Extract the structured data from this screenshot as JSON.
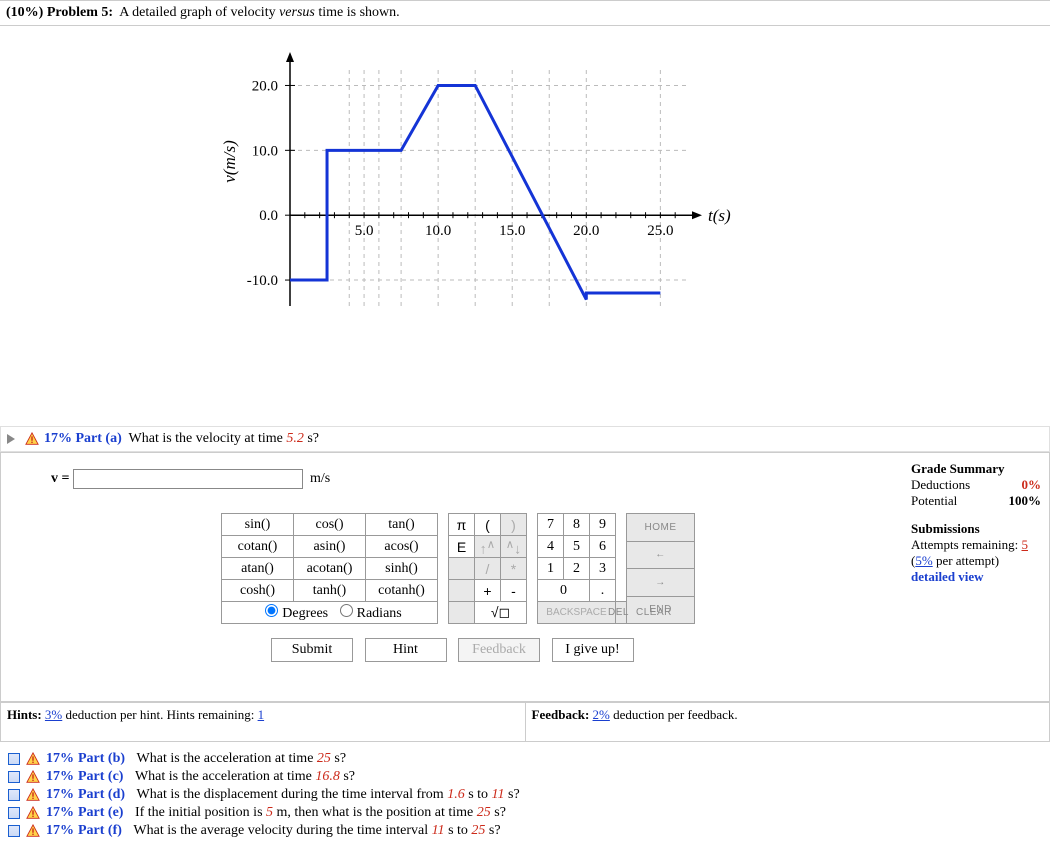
{
  "problem": {
    "weight": "(10%)",
    "number": "Problem 5:",
    "statement_pre": "A detailed graph of velocity ",
    "statement_it": "versus",
    "statement_post": " time is shown."
  },
  "chart_data": {
    "type": "line",
    "xlabel": "t(s)",
    "ylabel": "v(m/s)",
    "xlim": [
      0,
      27
    ],
    "ylim": [
      -14,
      23
    ],
    "xticks": [
      5.0,
      10.0,
      15.0,
      20.0,
      25.0
    ],
    "yticks": [
      -10.0,
      0.0,
      10.0,
      20.0
    ],
    "gridlines_x_minor": [
      2.5,
      4,
      5,
      6,
      7.5,
      10,
      12.5,
      15,
      17.5,
      20,
      25
    ],
    "series": [
      {
        "name": "velocity",
        "points": [
          {
            "x": 0.0,
            "y": -10.0
          },
          {
            "x": 2.5,
            "y": -10.0
          },
          {
            "x": 2.5,
            "y": 10.0
          },
          {
            "x": 7.5,
            "y": 10.0
          },
          {
            "x": 10.0,
            "y": 20.0
          },
          {
            "x": 12.5,
            "y": 20.0
          },
          {
            "x": 20.0,
            "y": -13.0
          },
          {
            "x": 20.0,
            "y": -12.0
          },
          {
            "x": 25.0,
            "y": -12.0
          }
        ]
      }
    ]
  },
  "part_a": {
    "percent": "17%",
    "label": "Part (a)",
    "question_pre": "What is the velocity at time ",
    "question_val": "5.2",
    "question_post": " s?",
    "var": "v =",
    "unit": "m/s",
    "input_value": ""
  },
  "grade": {
    "header": "Grade Summary",
    "deductions_label": "Deductions",
    "deductions_value": "0%",
    "potential_label": "Potential",
    "potential_value": "100%",
    "sub_header": "Submissions",
    "attempts_label": "Attempts remaining:",
    "attempts_value": "5",
    "per_attempt_pre": "(",
    "per_attempt_val": "5%",
    "per_attempt_post": " per attempt)",
    "detailed": "detailed view"
  },
  "keypad": {
    "func": [
      [
        "sin()",
        "cos()",
        "tan()"
      ],
      [
        "cotan()",
        "asin()",
        "acos()"
      ],
      [
        "atan()",
        "acotan()",
        "sinh()"
      ],
      [
        "cosh()",
        "tanh()",
        "cotanh()"
      ]
    ],
    "angle_deg": "Degrees",
    "angle_rad": "Radians",
    "sym": [
      [
        "π",
        "(",
        ")"
      ],
      [
        "E",
        "↑^",
        "^↓"
      ],
      [
        "",
        "/",
        "*"
      ],
      [
        "",
        "+",
        "-"
      ],
      [
        "",
        "√◻",
        ""
      ]
    ],
    "num": [
      [
        "7",
        "8",
        "9"
      ],
      [
        "4",
        "5",
        "6"
      ],
      [
        "1",
        "2",
        "3"
      ],
      [
        "0",
        "0",
        "."
      ],
      [
        "BACKSPACE",
        "BACKSPACE",
        "BACKSPACE"
      ]
    ],
    "ctrl": [
      "HOME",
      "←",
      "→",
      "END",
      "DEL",
      "CLEAR"
    ]
  },
  "actions": {
    "submit": "Submit",
    "hint": "Hint",
    "feedback": "Feedback",
    "giveup": "I give up!"
  },
  "hints_bar": {
    "hints_pre": "Hints: ",
    "hints_pct": "3%",
    "hints_mid": " deduction per hint. Hints remaining: ",
    "hints_rem": "1",
    "fb_pre": "Feedback: ",
    "fb_pct": "2%",
    "fb_post": " deduction per feedback."
  },
  "parts": [
    {
      "pct": "17%",
      "label": "Part (b)",
      "pre": "What is the acceleration at time ",
      "v1": "25",
      "post": " s?"
    },
    {
      "pct": "17%",
      "label": "Part (c)",
      "pre": "What is the acceleration at time ",
      "v1": "16.8",
      "post": " s?"
    },
    {
      "pct": "17%",
      "label": "Part (d)",
      "pre": "What is the displacement during the time interval from ",
      "v1": "1.6",
      "mid": " s to ",
      "v2": "11",
      "post": " s?"
    },
    {
      "pct": "17%",
      "label": "Part (e)",
      "pre": "If the initial position is ",
      "v1": "5",
      "mid": " m, then what is the position at time ",
      "v2": "25",
      "post": " s?"
    },
    {
      "pct": "17%",
      "label": "Part (f)",
      "pre": "What is the average velocity during the time interval ",
      "v1": "11",
      "mid": " s to ",
      "v2": "25",
      "post": " s?"
    }
  ]
}
